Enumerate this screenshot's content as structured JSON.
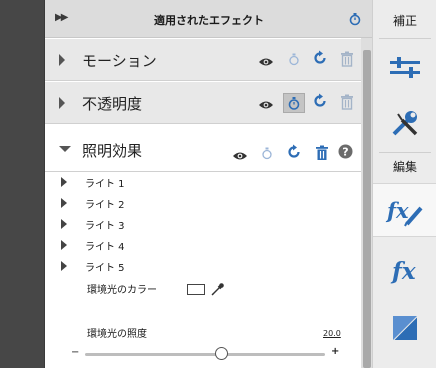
{
  "header": {
    "collapse_icon": "double-chevron-right-icon",
    "title": "適用されたエフェクト",
    "timer_icon": "stopwatch-icon"
  },
  "effects": [
    {
      "label": "モーション",
      "expanded": false
    },
    {
      "label": "不透明度",
      "expanded": false
    },
    {
      "label": "照明効果",
      "expanded": true
    }
  ],
  "lights": [
    "ライト 1",
    "ライト 2",
    "ライト 3",
    "ライト 4",
    "ライト 5"
  ],
  "ambient_color": {
    "label": "環境光のカラー"
  },
  "ambient_intensity": {
    "label": "環境光の照度",
    "value": "20.0",
    "minus": "−",
    "plus": "+",
    "slider_fraction": 0.57
  },
  "right_bar": {
    "adjust_label": "補正",
    "edit_label": "編集"
  },
  "colors": {
    "accent_blue": "#2d6db5",
    "header_bg": "#dcdcdc",
    "row_bg": "#e8e8e8"
  }
}
